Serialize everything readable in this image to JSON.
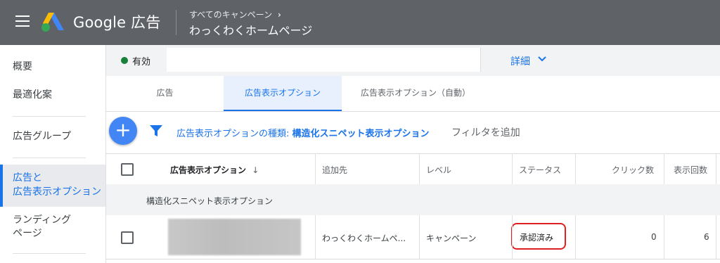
{
  "header": {
    "brand": "Google 広告",
    "breadcrumb": "すべてのキャンペーン",
    "campaign_name": "わっくわくホームページ"
  },
  "sidebar": {
    "items": [
      {
        "label": "概要"
      },
      {
        "label": "最適化案"
      },
      {
        "label": "広告グループ"
      },
      {
        "label_line1": "広告と",
        "label_line2": "広告表示オプション",
        "active": true
      },
      {
        "label_line1": "ランディング",
        "label_line2": "ページ"
      }
    ]
  },
  "status": {
    "label": "有効",
    "details": "詳細",
    "color": "#188038"
  },
  "tabs": [
    {
      "label": "広告"
    },
    {
      "label": "広告表示オプション",
      "active": true
    },
    {
      "label": "広告表示オプション（自動）"
    }
  ],
  "filter": {
    "prefix": "広告表示オプションの種類: ",
    "value": "構造化スニペット表示オプション",
    "add": "フィルタを追加"
  },
  "table": {
    "columns": [
      "広告表示オプション",
      "追加先",
      "レベル",
      "ステータス",
      "クリック数",
      "表示回数"
    ],
    "sort_indicator": "↓",
    "group_label": "構造化スニペット表示オプション",
    "rows": [
      {
        "added_to": "わっくわくホームペ...",
        "level": "キャンペーン",
        "status": "承認済み",
        "clicks": "0",
        "impressions": "6"
      }
    ]
  },
  "colors": {
    "accent": "#1a73e8",
    "topbar": "#5f6368",
    "highlight": "#e02020"
  }
}
